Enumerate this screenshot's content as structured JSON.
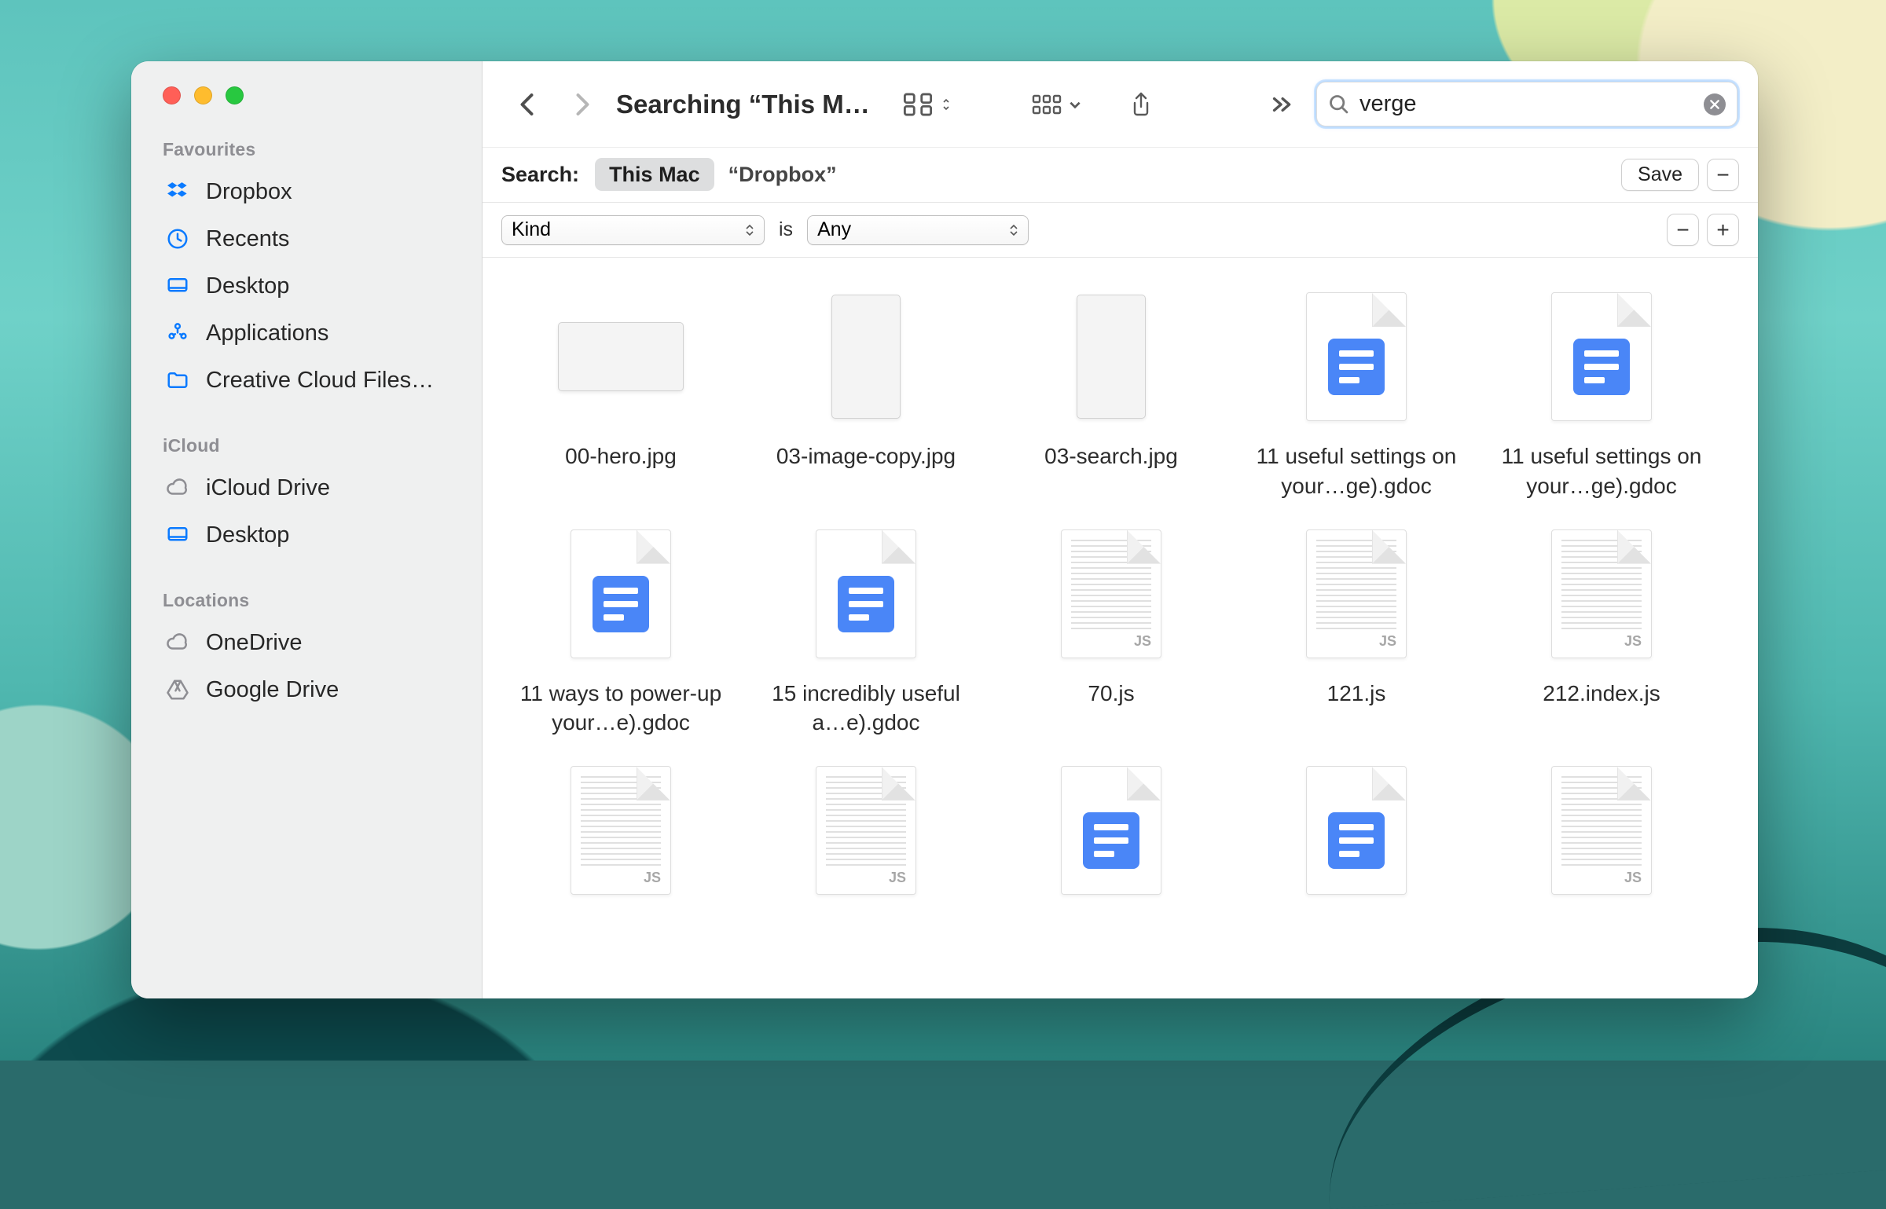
{
  "window_title": "Searching “This M…",
  "sidebar": {
    "sections": [
      {
        "heading": "Favourites",
        "items": [
          {
            "label": "Dropbox",
            "icon": "dropbox",
            "icon_color": "blue"
          },
          {
            "label": "Recents",
            "icon": "clock",
            "icon_color": "blue"
          },
          {
            "label": "Desktop",
            "icon": "desktop",
            "icon_color": "blue"
          },
          {
            "label": "Applications",
            "icon": "apps",
            "icon_color": "blue"
          },
          {
            "label": "Creative Cloud Files…",
            "icon": "folder",
            "icon_color": "blue"
          }
        ]
      },
      {
        "heading": "iCloud",
        "items": [
          {
            "label": "iCloud Drive",
            "icon": "cloud",
            "icon_color": "gray"
          },
          {
            "label": "Desktop",
            "icon": "desktop",
            "icon_color": "blue"
          }
        ]
      },
      {
        "heading": "Locations",
        "items": [
          {
            "label": "OneDrive",
            "icon": "cloud",
            "icon_color": "gray"
          },
          {
            "label": "Google Drive",
            "icon": "gdrive",
            "icon_color": "gray"
          }
        ]
      }
    ]
  },
  "search": {
    "value": "verge",
    "placeholder": "Search"
  },
  "scopebar": {
    "label": "Search:",
    "scopes": [
      {
        "label": "This Mac",
        "active": true
      },
      {
        "label": "“Dropbox”",
        "active": false
      }
    ],
    "save_label": "Save"
  },
  "criteria": {
    "attribute": "Kind",
    "operator": "is",
    "value": "Any"
  },
  "files": [
    {
      "name": "00-hero.jpg",
      "thumb": "image-wide"
    },
    {
      "name": "03-image-copy.jpg",
      "thumb": "image-tall"
    },
    {
      "name": "03-search.jpg",
      "thumb": "image-tall"
    },
    {
      "name": "11 useful settings on your…ge).gdoc",
      "thumb": "gdoc"
    },
    {
      "name": "11 useful settings on your…ge).gdoc",
      "thumb": "gdoc"
    },
    {
      "name": "11 ways to power-up your…e).gdoc",
      "thumb": "gdoc"
    },
    {
      "name": "15 incredibly useful a…e).gdoc",
      "thumb": "gdoc"
    },
    {
      "name": "70.js",
      "thumb": "js"
    },
    {
      "name": "121.js",
      "thumb": "js"
    },
    {
      "name": "212.index.js",
      "thumb": "js"
    },
    {
      "name": "",
      "thumb": "js"
    },
    {
      "name": "",
      "thumb": "js"
    },
    {
      "name": "",
      "thumb": "gdoc"
    },
    {
      "name": "",
      "thumb": "gdoc"
    },
    {
      "name": "",
      "thumb": "js"
    }
  ]
}
